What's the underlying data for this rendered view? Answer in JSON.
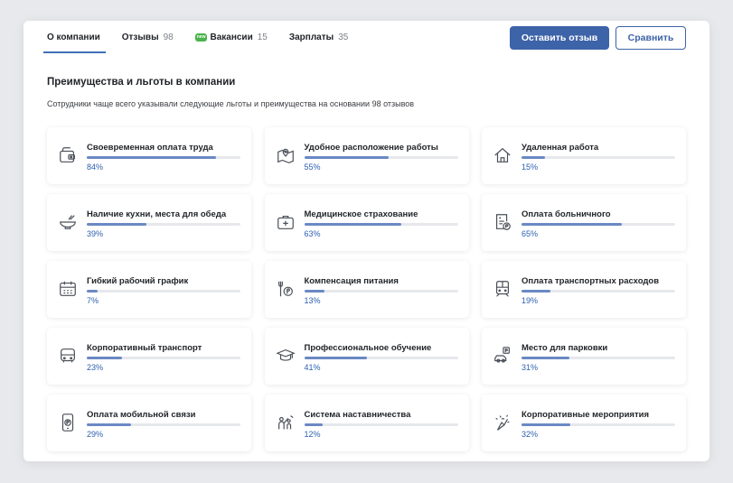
{
  "tabs": [
    {
      "label": "О компании",
      "count": ""
    },
    {
      "label": "Отзывы",
      "count": "98"
    },
    {
      "badge": "new",
      "label": "Вакансии",
      "count": "15"
    },
    {
      "label": "Зарплаты",
      "count": "35"
    }
  ],
  "actions": {
    "primary": "Оставить отзыв",
    "secondary": "Сравнить"
  },
  "section": {
    "title": "Преимущества и льготы в компании",
    "subtitle": "Сотрудники чаще всего указывали следующие льготы и преимущества на основании 98 отзывов"
  },
  "benefits": [
    {
      "label": "Своевременная оплата труда",
      "percent": "84%",
      "value": 84,
      "icon": "wallet-icon"
    },
    {
      "label": "Удобное расположение работы",
      "percent": "55%",
      "value": 55,
      "icon": "map-pin-icon"
    },
    {
      "label": "Удаленная работа",
      "percent": "15%",
      "value": 15,
      "icon": "home-icon"
    },
    {
      "label": "Наличие кухни, места для обеда",
      "percent": "39%",
      "value": 39,
      "icon": "bowl-icon"
    },
    {
      "label": "Медицинское страхование",
      "percent": "63%",
      "value": 63,
      "icon": "medical-kit-icon"
    },
    {
      "label": "Оплата больничного",
      "percent": "65%",
      "value": 65,
      "icon": "sick-leave-doc-icon"
    },
    {
      "label": "Гибкий рабочий график",
      "percent": "7%",
      "value": 7,
      "icon": "calendar-icon"
    },
    {
      "label": "Компенсация питания",
      "percent": "13%",
      "value": 13,
      "icon": "food-ruble-icon"
    },
    {
      "label": "Оплата транспортных расходов",
      "percent": "19%",
      "value": 19,
      "icon": "train-icon"
    },
    {
      "label": "Корпоративный транспорт",
      "percent": "23%",
      "value": 23,
      "icon": "bus-icon"
    },
    {
      "label": "Профессиональное обучение",
      "percent": "41%",
      "value": 41,
      "icon": "graduation-cap-icon"
    },
    {
      "label": "Место для парковки",
      "percent": "31%",
      "value": 31,
      "icon": "parking-car-icon"
    },
    {
      "label": "Оплата мобильной связи",
      "percent": "29%",
      "value": 29,
      "icon": "mobile-payment-icon"
    },
    {
      "label": "Система наставничества",
      "percent": "12%",
      "value": 12,
      "icon": "mentoring-icon"
    },
    {
      "label": "Корпоративные мероприятия",
      "percent": "32%",
      "value": 32,
      "icon": "celebration-icon"
    }
  ],
  "colors": {
    "accent": "#3d63a8",
    "bar": "#6a88c4",
    "badge": "#4bb34b"
  }
}
